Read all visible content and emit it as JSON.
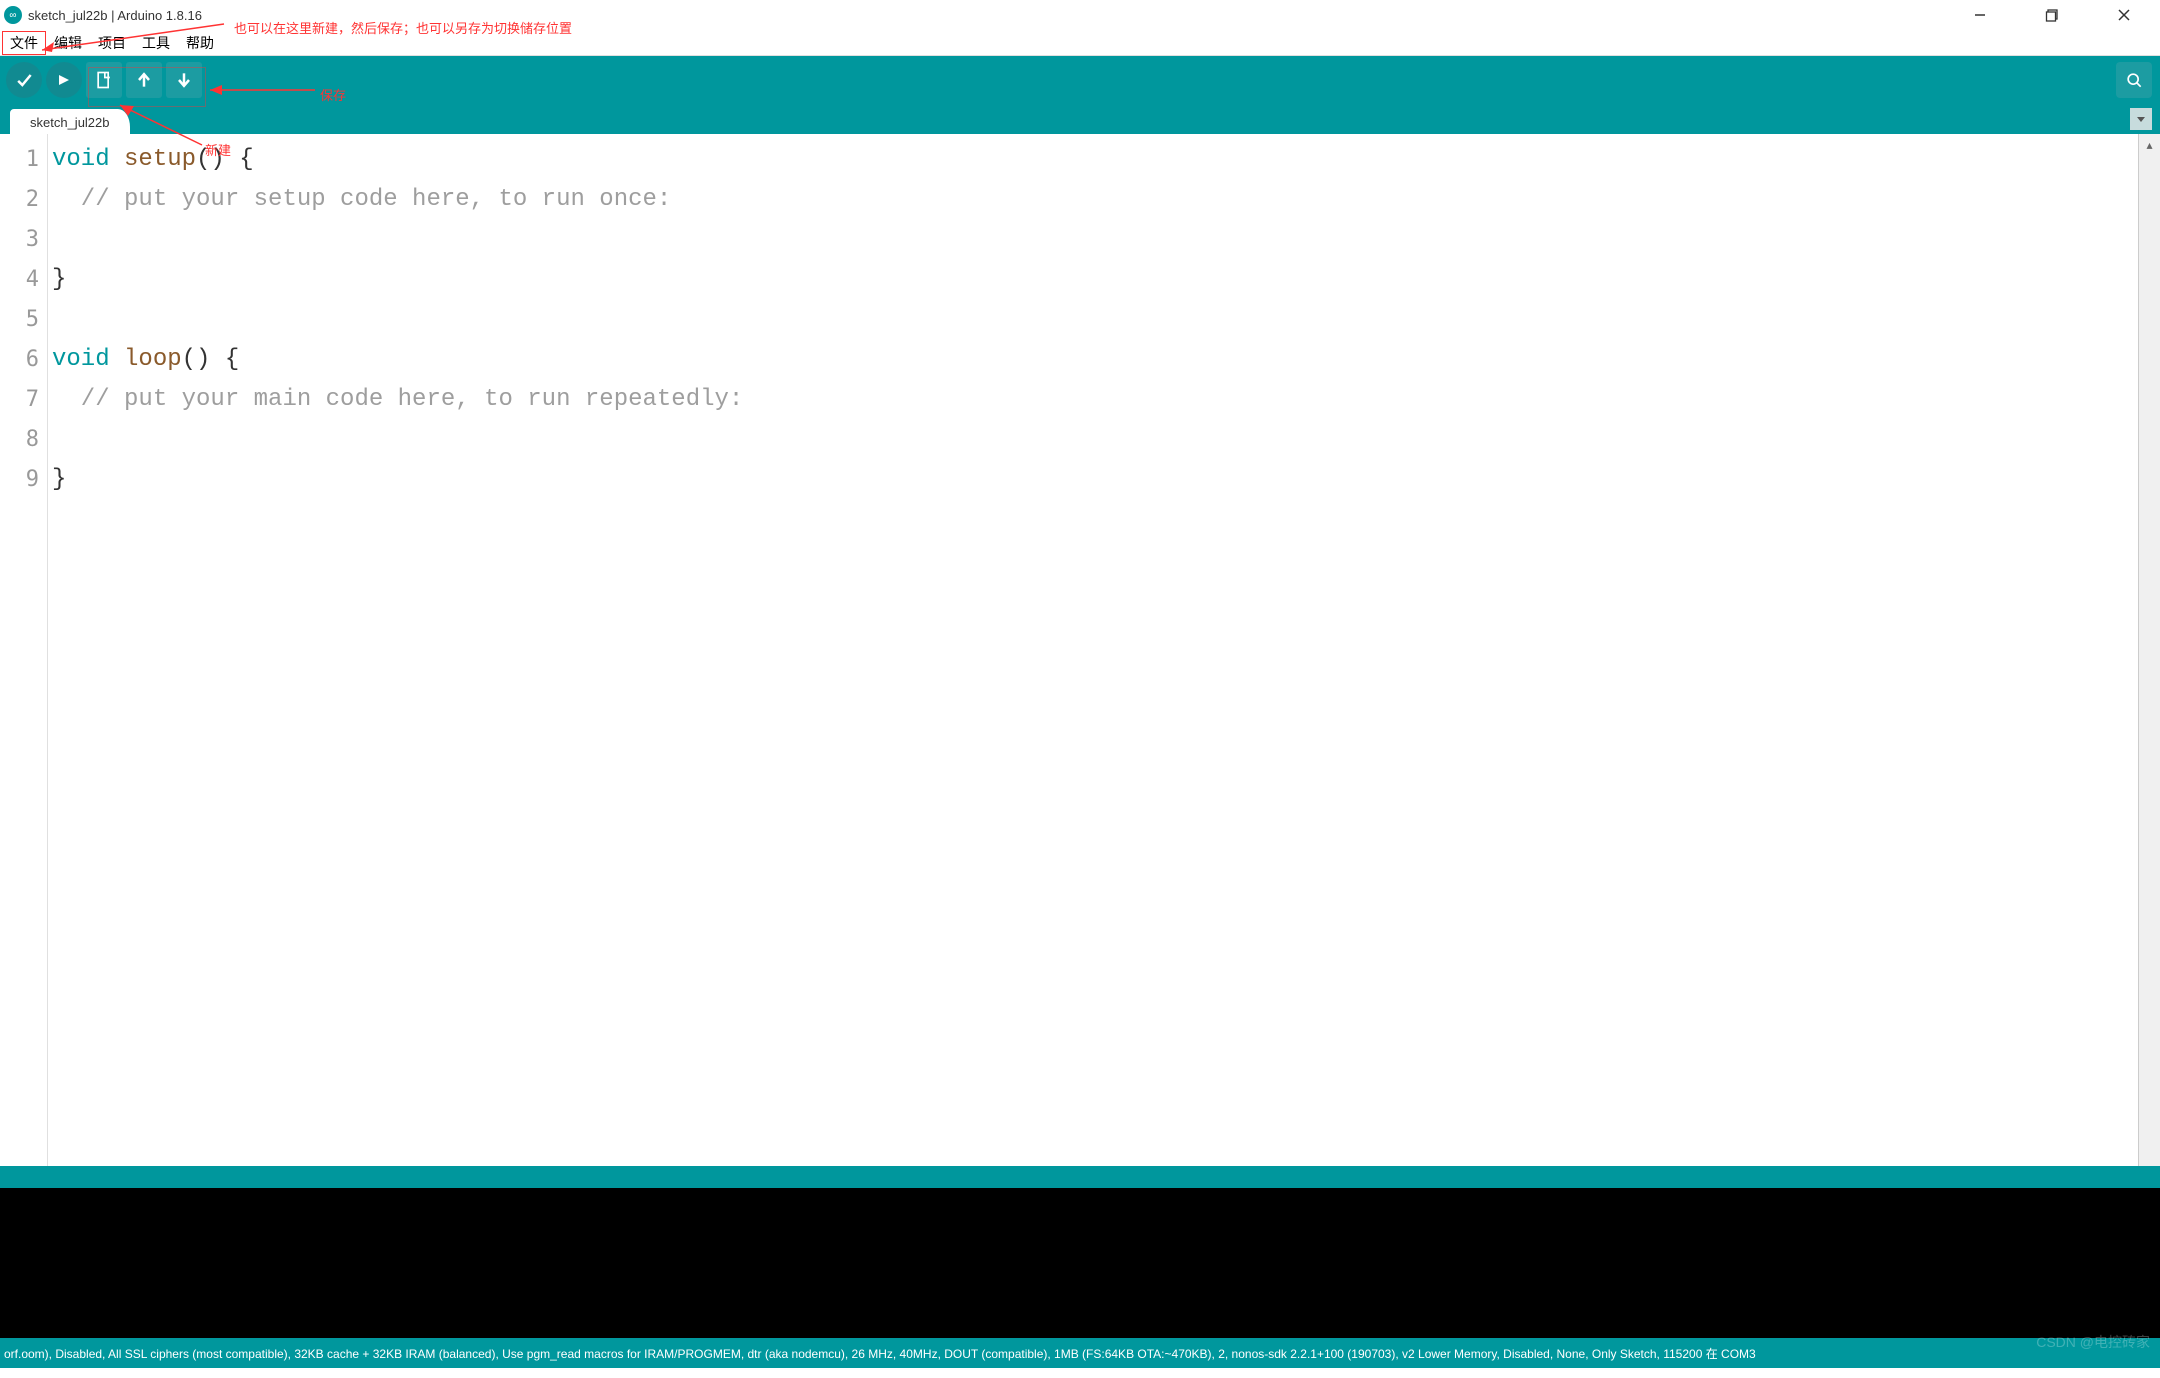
{
  "titlebar": {
    "title": "sketch_jul22b | Arduino 1.8.16"
  },
  "menubar": {
    "items": [
      "文件",
      "编辑",
      "项目",
      "工具",
      "帮助"
    ]
  },
  "toolbar": {
    "verify_tip": "verify",
    "upload_tip": "upload",
    "new_tip": "new",
    "open_tip": "open",
    "save_tip": "save",
    "serial_tip": "serial-monitor"
  },
  "tabs": {
    "active": "sketch_jul22b"
  },
  "code": {
    "lines": [
      {
        "n": 1,
        "t": "void",
        "sp": " ",
        "fn": "setup",
        "rest": "() {"
      },
      {
        "n": 2,
        "t": "",
        "cm": "  // put your setup code here, to run once:"
      },
      {
        "n": 3,
        "t": "",
        "plain": ""
      },
      {
        "n": 4,
        "t": "",
        "plain": "}"
      },
      {
        "n": 5,
        "t": "",
        "plain": ""
      },
      {
        "n": 6,
        "t": "void",
        "sp": " ",
        "fn": "loop",
        "rest": "() {"
      },
      {
        "n": 7,
        "t": "",
        "cm": "  // put your main code here, to run repeatedly:"
      },
      {
        "n": 8,
        "t": "",
        "plain": ""
      },
      {
        "n": 9,
        "t": "",
        "plain": "}"
      }
    ]
  },
  "annotations": {
    "line1": "也可以在这里新建，然后保存；也可以另存为切换储存位置",
    "line2": "保存",
    "line3": "新建"
  },
  "statusbar": {
    "text": "orf.oom), Disabled, All SSL ciphers (most compatible), 32KB cache + 32KB IRAM (balanced), Use pgm_read macros for IRAM/PROGMEM, dtr (aka nodemcu), 26 MHz, 40MHz, DOUT (compatible), 1MB (FS:64KB OTA:~470KB), 2, nonos-sdk 2.2.1+100 (190703), v2 Lower Memory, Disabled, None, Only Sketch, 115200 在 COM3"
  },
  "watermark": "CSDN @电控砖家"
}
